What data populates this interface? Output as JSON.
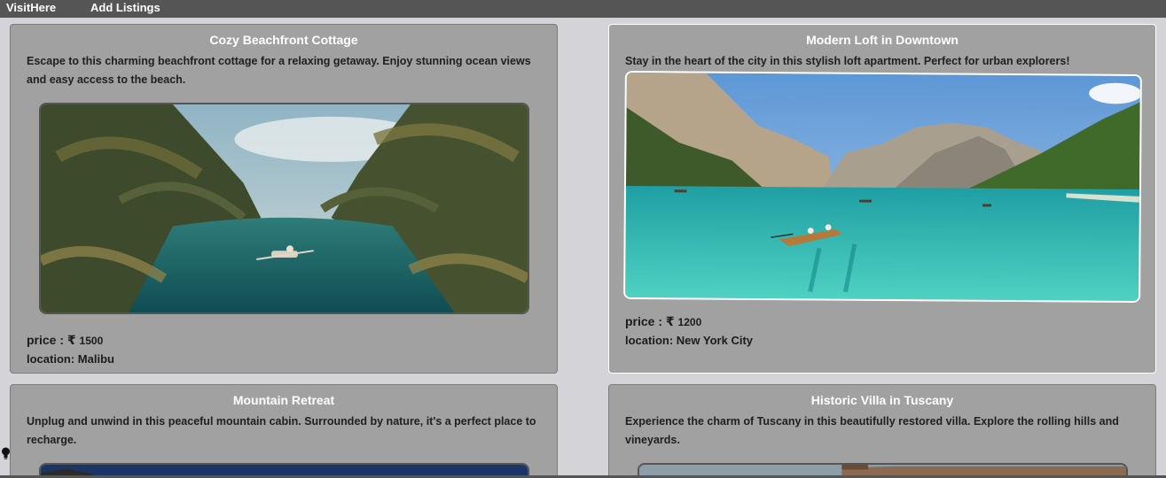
{
  "nav": {
    "brand": "VisitHere",
    "add_listings": "Add Listings"
  },
  "listings": [
    {
      "title": "Cozy Beachfront Cottage",
      "description": "Escape to this charming beachfront cottage for a relaxing getaway. Enjoy stunning ocean views and easy access to the beach.",
      "price_label": "price : ₹",
      "price": "1500",
      "location_label": "location:",
      "location": "Malibu",
      "image_icon": "tropical-river-photo"
    },
    {
      "title": "Modern Loft in Downtown",
      "description": "Stay in the heart of the city in this stylish loft apartment. Perfect for urban explorers!",
      "price_label": "price : ₹",
      "price": "1200",
      "location_label": "location:",
      "location": "New York City",
      "image_icon": "mountain-lake-photo"
    },
    {
      "title": "Mountain Retreat",
      "description": "Unplug and unwind in this peaceful mountain cabin. Surrounded by nature, it's a perfect place to recharge.",
      "image_icon": "mountain-cabin-photo"
    },
    {
      "title": "Historic Villa in Tuscany",
      "description": "Experience the charm of Tuscany in this beautifully restored villa. Explore the rolling hills and vineyards.",
      "image_icon": "tuscany-villa-photo"
    }
  ],
  "colors": {
    "navbar": "#555555",
    "page_bg": "#d4d4d8",
    "card_bg": "#a1a1a1",
    "title_text": "#ffffff"
  }
}
